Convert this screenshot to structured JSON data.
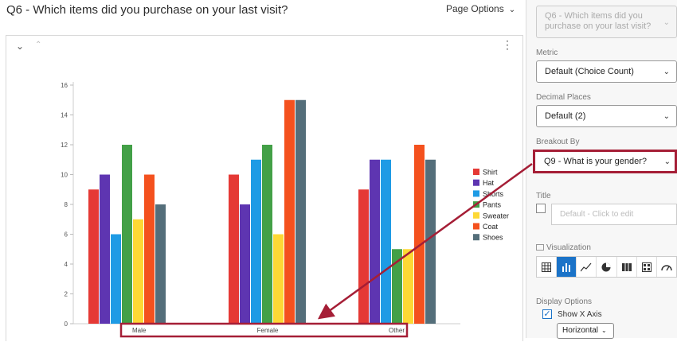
{
  "header": {
    "question_title": "Q6 - Which items did you purchase on your last visit?",
    "page_options": "Page Options"
  },
  "panel": {
    "question_select": "Q6 - Which items did you purchase on your last visit?",
    "metric_label": "Metric",
    "metric_value": "Default (Choice Count)",
    "decimal_label": "Decimal Places",
    "decimal_value": "Default (2)",
    "breakout_label": "Breakout By",
    "breakout_value": "Q9 - What is your gender?",
    "title_label": "Title",
    "title_placeholder": "Default - Click to edit",
    "visualization_label": "Visualization",
    "display_options_label": "Display Options",
    "show_x_axis_label": "Show X Axis",
    "x_axis_orientation": "Horizontal",
    "viz_icons": [
      "table-icon",
      "bar-chart-icon",
      "line-chart-icon",
      "pie-chart-icon",
      "breakdown-bar-icon",
      "grid-icon",
      "gauge-icon"
    ]
  },
  "colors": {
    "highlight": "#a51e36",
    "accent": "#1b73c8"
  },
  "chart_data": {
    "type": "bar",
    "categories": [
      "Male",
      "Female",
      "Other"
    ],
    "ylim": [
      0,
      16
    ],
    "yticks": [
      0,
      2,
      4,
      6,
      8,
      10,
      12,
      14,
      16
    ],
    "series": [
      {
        "name": "Shirt",
        "color": "#e53935",
        "values": [
          9,
          10,
          9
        ]
      },
      {
        "name": "Hat",
        "color": "#5e35b1",
        "values": [
          10,
          8,
          11
        ]
      },
      {
        "name": "Shorts",
        "color": "#1e9be5",
        "values": [
          6,
          11,
          11
        ]
      },
      {
        "name": "Pants",
        "color": "#43a047",
        "values": [
          12,
          12,
          5
        ]
      },
      {
        "name": "Sweater",
        "color": "#fdd835",
        "values": [
          7,
          6,
          5
        ]
      },
      {
        "name": "Coat",
        "color": "#f4511e",
        "values": [
          10,
          15,
          12
        ]
      },
      {
        "name": "Shoes",
        "color": "#546e7a",
        "values": [
          8,
          15,
          11
        ]
      }
    ]
  }
}
